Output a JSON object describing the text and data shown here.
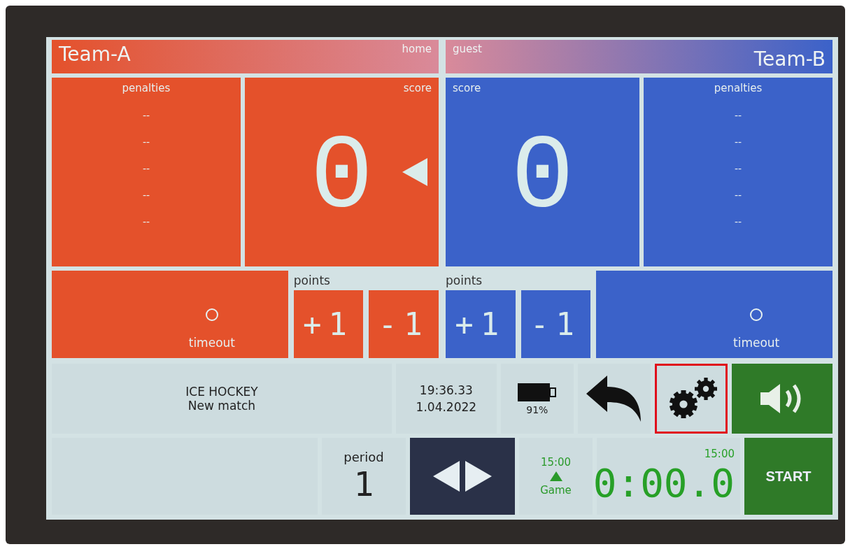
{
  "teams": [
    {
      "kind": "home",
      "name": "Team-A",
      "side_label": "home",
      "color": "#e4512b",
      "penalties_label": "penalties",
      "penalties": [
        "--",
        "--",
        "--",
        "--",
        "--"
      ],
      "score_label": "score",
      "score": "0",
      "possession": true,
      "timeout_label": "timeout",
      "timeout_used": false,
      "points_label": "points",
      "point_buttons": [
        "+1",
        "-1"
      ]
    },
    {
      "kind": "guest",
      "name": "Team-B",
      "side_label": "guest",
      "color": "#3b62c9",
      "penalties_label": "penalties",
      "penalties": [
        "--",
        "--",
        "--",
        "--",
        "--"
      ],
      "score_label": "score",
      "score": "0",
      "possession": false,
      "timeout_label": "timeout",
      "timeout_used": false,
      "points_label": "points",
      "point_buttons": [
        "+1",
        "-1"
      ]
    }
  ],
  "status": {
    "sport": "ICE HOCKEY",
    "match": "New match",
    "time": "19:36.33",
    "date": "1.04.2022",
    "battery": "91%"
  },
  "toolbar": [
    {
      "kind": "back",
      "highlighted": false
    },
    {
      "kind": "settings",
      "highlighted": true
    },
    {
      "kind": "sound",
      "highlighted": false
    }
  ],
  "period": {
    "label": "period",
    "value": "1"
  },
  "game": {
    "duration": "15:00",
    "label": "Game"
  },
  "timer": {
    "limit": "15:00",
    "value": "0:00.0"
  },
  "start_button": "START"
}
